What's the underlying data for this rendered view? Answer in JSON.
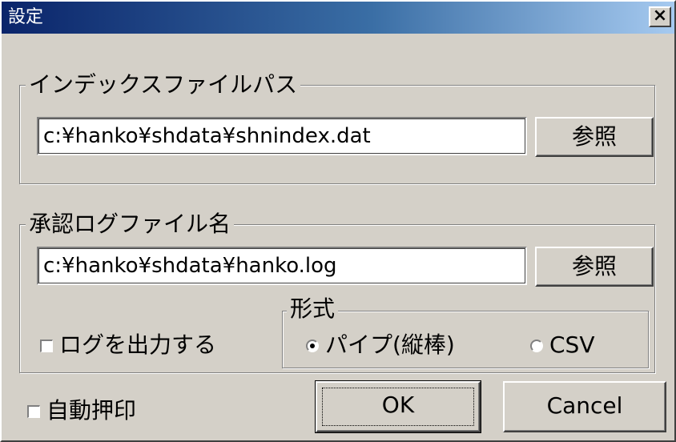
{
  "window": {
    "title": "設定",
    "close_label": "×"
  },
  "index_group": {
    "label": "インデックスファイルパス",
    "path_value": "c:¥hanko¥shdata¥shnindex.dat",
    "browse_label": "参照"
  },
  "log_group": {
    "label": "承認ログファイル名",
    "path_value": "c:¥hanko¥shdata¥hanko.log",
    "browse_label": "参照",
    "output_log_label": "ログを出力する",
    "output_log_checked": false
  },
  "format_group": {
    "label": "形式",
    "options": [
      {
        "label": "パイプ(縦棒)",
        "selected": true
      },
      {
        "label": "CSV",
        "selected": false
      }
    ]
  },
  "auto_stamp": {
    "label": "自動押印",
    "checked": false
  },
  "buttons": {
    "ok_label": "OK",
    "cancel_label": "Cancel"
  },
  "colors": {
    "face": "#d4d0c8",
    "title_start": "#0a246a",
    "title_end": "#a6caf0"
  }
}
